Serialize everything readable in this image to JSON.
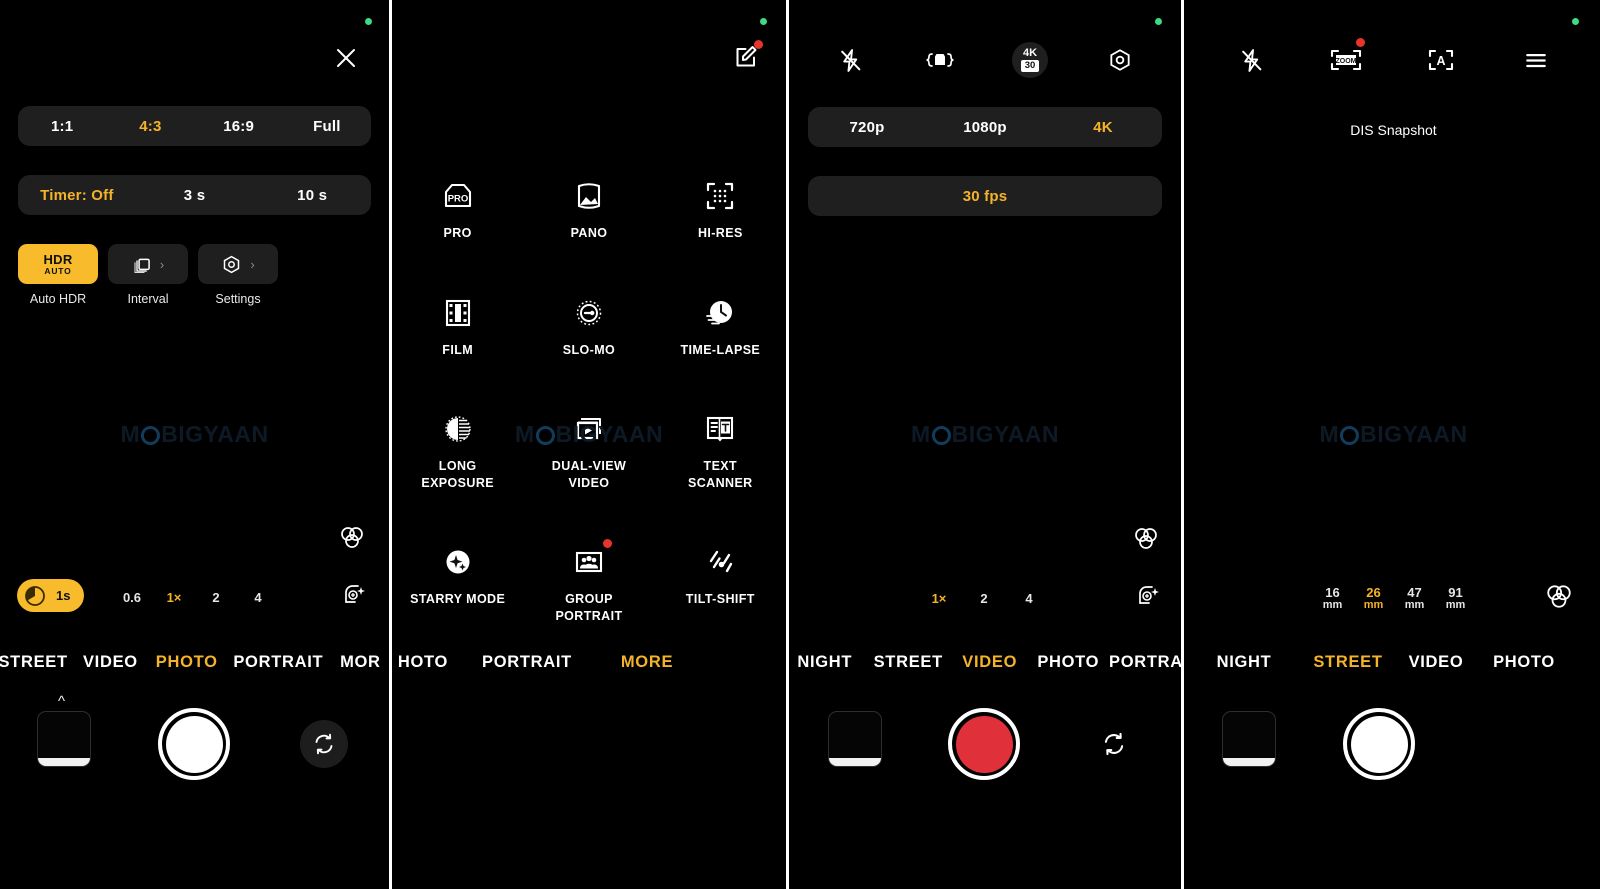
{
  "app": {
    "watermark": "MOBIGYAAN",
    "accent_yellow": "#f5b329",
    "tile_yellow": "#f7bb2b",
    "record_red": "#e0313a",
    "panel_bg": "#000000",
    "pill_bg": "#1f1f1f",
    "privacy_dot_color": "#3ddc84",
    "badge_red": "#e8352c"
  },
  "panel1": {
    "name": "photo-quick-settings",
    "close_label": "×",
    "aspect_ratio": {
      "label": "aspect-ratio",
      "options": [
        "1:1",
        "4:3",
        "16:9",
        "Full"
      ],
      "active": "4:3"
    },
    "timer": {
      "label": "timer",
      "options": [
        "Timer: Off",
        "3 s",
        "10 s"
      ],
      "active": "Timer: Off"
    },
    "tiles": [
      {
        "id": "auto-hdr",
        "icon_big": "HDR",
        "icon_small": "AUTO",
        "label": "Auto HDR",
        "active": true
      },
      {
        "id": "interval",
        "icon": "stack-icon",
        "chevron": "›",
        "label": "Interval",
        "active": false
      },
      {
        "id": "settings",
        "icon": "aperture-hex-icon",
        "chevron": "›",
        "label": "Settings",
        "active": false
      }
    ],
    "timer_badge": "1s",
    "zoom": {
      "options": [
        "0.6",
        "1×",
        "2",
        "4"
      ],
      "active": "1×"
    },
    "mode_tabs": {
      "items": [
        "STREET",
        "VIDEO",
        "PHOTO",
        "PORTRAIT",
        "MOR"
      ],
      "active": "PHOTO"
    },
    "shutter": {
      "type": "photo"
    }
  },
  "panel2": {
    "name": "more-modes",
    "edit_icon": "edit-square-icon",
    "modes": [
      {
        "label": "PRO",
        "icon": "pro-camera-icon",
        "badge": false
      },
      {
        "label": "PANO",
        "icon": "panorama-icon",
        "badge": false
      },
      {
        "label": "HI-RES",
        "icon": "hi-res-icon",
        "badge": false
      },
      {
        "label": "FILM",
        "icon": "film-strip-icon",
        "badge": false
      },
      {
        "label": "SLO-MO",
        "icon": "slow-motion-icon",
        "badge": false
      },
      {
        "label": "TIME-LAPSE",
        "icon": "time-lapse-clock-icon",
        "badge": false
      },
      {
        "label": "LONG\nEXPOSURE",
        "icon": "long-exposure-icon",
        "badge": false
      },
      {
        "label": "DUAL-VIEW\nVIDEO",
        "icon": "dual-view-video-icon",
        "badge": false
      },
      {
        "label": "TEXT\nSCANNER",
        "icon": "text-scanner-icon",
        "badge": false
      },
      {
        "label": "STARRY MODE",
        "icon": "starry-mode-icon",
        "badge": false
      },
      {
        "label": "GROUP\nPORTRAIT",
        "icon": "group-portrait-icon",
        "badge": true
      },
      {
        "label": "TILT-SHIFT",
        "icon": "tilt-shift-icon",
        "badge": false
      }
    ],
    "mode_tabs": {
      "items": [
        "HOTO",
        "PORTRAIT",
        "MORE"
      ],
      "active": "MORE"
    }
  },
  "panel3": {
    "name": "video-settings",
    "topbar": [
      {
        "id": "flash-off",
        "icon": "flash-off-icon"
      },
      {
        "id": "video-frame",
        "icon": "video-bracket-icon"
      },
      {
        "id": "quality-badge",
        "icon": "4k-30-badge",
        "badge_top": "4K",
        "badge_bottom": "30"
      },
      {
        "id": "settings",
        "icon": "aperture-hex-icon"
      }
    ],
    "resolution": {
      "options": [
        "720p",
        "1080p",
        "4K"
      ],
      "active": "4K"
    },
    "framerate": {
      "options": [
        "30 fps"
      ],
      "active": "30 fps"
    },
    "zoom": {
      "options": [
        "1×",
        "2",
        "4"
      ],
      "active": "1×"
    },
    "mode_tabs": {
      "items": [
        "NIGHT",
        "STREET",
        "VIDEO",
        "PHOTO",
        "PORTRA"
      ],
      "active": "VIDEO"
    },
    "shutter": {
      "type": "video"
    }
  },
  "panel4": {
    "name": "street-mode",
    "topbar": [
      {
        "id": "flash-off",
        "icon": "flash-off-icon",
        "badge": false
      },
      {
        "id": "zoom-frame",
        "icon": "zoom-frame-icon",
        "badge": true
      },
      {
        "id": "auto-focus",
        "icon": "auto-bracket-icon",
        "badge": false
      },
      {
        "id": "menu",
        "icon": "hamburger-icon",
        "badge": false
      }
    ],
    "status_text": "DIS Snapshot",
    "focal_lengths": {
      "options": [
        "16",
        "26",
        "47",
        "91"
      ],
      "unit": "mm",
      "active": "26"
    },
    "mode_tabs": {
      "items": [
        "NIGHT",
        "STREET",
        "VIDEO",
        "PHOTO"
      ],
      "active": "STREET"
    },
    "shutter": {
      "type": "photo"
    }
  }
}
